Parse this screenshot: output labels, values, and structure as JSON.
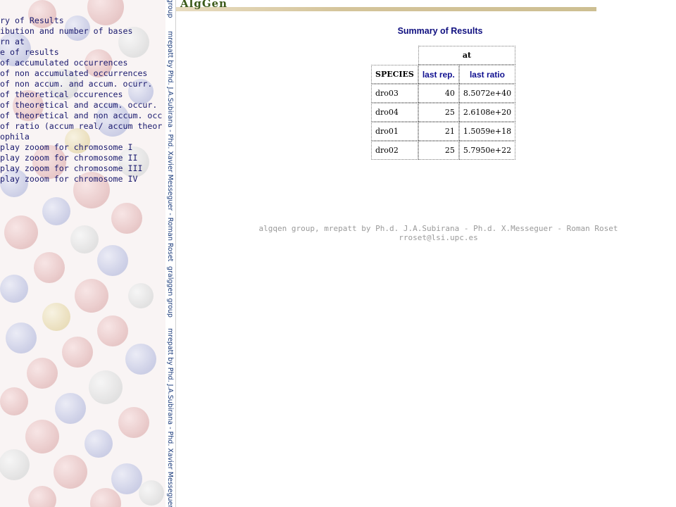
{
  "menu": {
    "items": [
      "ry of Results",
      "ibution and number of bases",
      "rn at",
      "e of results",
      " of accumulated occurrences",
      " of non accumulated occurrences",
      " of non accum. and accum. ocurr.",
      " of theoretical occurences",
      " of theoretical and accum. occur.",
      " of theoretical and non accum. occ",
      " of ratio (accum real/ accum theor",
      "ophila",
      "play zooom for chromosome I",
      "play zooom for chromosome II",
      "play zooom for chromosome III",
      "play zooom for chromosome IV"
    ]
  },
  "credits": {
    "segments": [
      "group",
      "mrepatt by Phd. J.A.Subirana - Phd. Xavier Messeguer - Roman Roset",
      "gralggen group",
      "mrepatt by Phd. J.A.Subirana - Phd. Xavier Messeguer"
    ]
  },
  "banner": {
    "logo_text": "AlgGen"
  },
  "summary": {
    "title": "Summary of Results",
    "pattern_header": "at",
    "columns": {
      "species": "SPECIES",
      "last_rep": "last rep.",
      "last_ratio": "last ratio"
    },
    "rows": [
      {
        "species": "dro03",
        "last_rep": "40",
        "last_ratio": "8.5072e+40"
      },
      {
        "species": "dro04",
        "last_rep": "25",
        "last_ratio": "2.6108e+20"
      },
      {
        "species": "dro01",
        "last_rep": "21",
        "last_ratio": "1.5059e+18"
      },
      {
        "species": "dro02",
        "last_rep": "25",
        "last_ratio": "5.7950e+22"
      }
    ]
  },
  "footer": {
    "line1": "algqen group, mrepatt by Ph.d. J.A.Subirana - Ph.d. X.Messeguer - Roman Roset",
    "line2": "rroset@lsi.upc.es"
  },
  "colors": {
    "link_blue": "#101080",
    "menu_text": "#1a1a6e",
    "footer_gray": "#9a9a9a",
    "banner_tan": "#cdbf92"
  }
}
